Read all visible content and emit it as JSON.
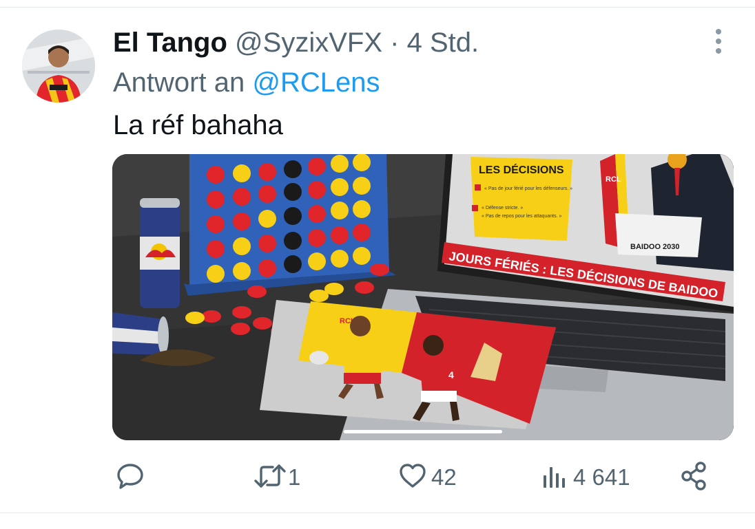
{
  "tweet": {
    "display_name": "El Tango",
    "handle": "@SyzixVFX",
    "separator": "·",
    "time": "4 Std.",
    "reply_prefix": "Antwort an",
    "reply_to": "@RCLens",
    "text": "La réf bahaha"
  },
  "image": {
    "panel_title": "LES DÉCISIONS",
    "panel_items": [
      "« Pas de jour férié pour les défenseurs. »",
      "« Défense stricte. »",
      "« Pas de repos pour les attaquants. »"
    ],
    "banner": "JOURS FÉRIÉS : LES DÉCISIONS DE BAIDOO",
    "podium_label": "BAIDOO 2030",
    "flag_label": "RCL",
    "card_label": "RCL",
    "player_number": "4"
  },
  "actions": {
    "reply_icon": "comment-icon",
    "retweet_icon": "retweet-icon",
    "retweet_count": "1",
    "like_icon": "heart-icon",
    "like_count": "42",
    "views_icon": "bar-chart-icon",
    "views_count": "4 641",
    "share_icon": "share-icon"
  },
  "colors": {
    "text": "#0f1419",
    "muted": "#536471",
    "link": "#1d9bf0"
  }
}
